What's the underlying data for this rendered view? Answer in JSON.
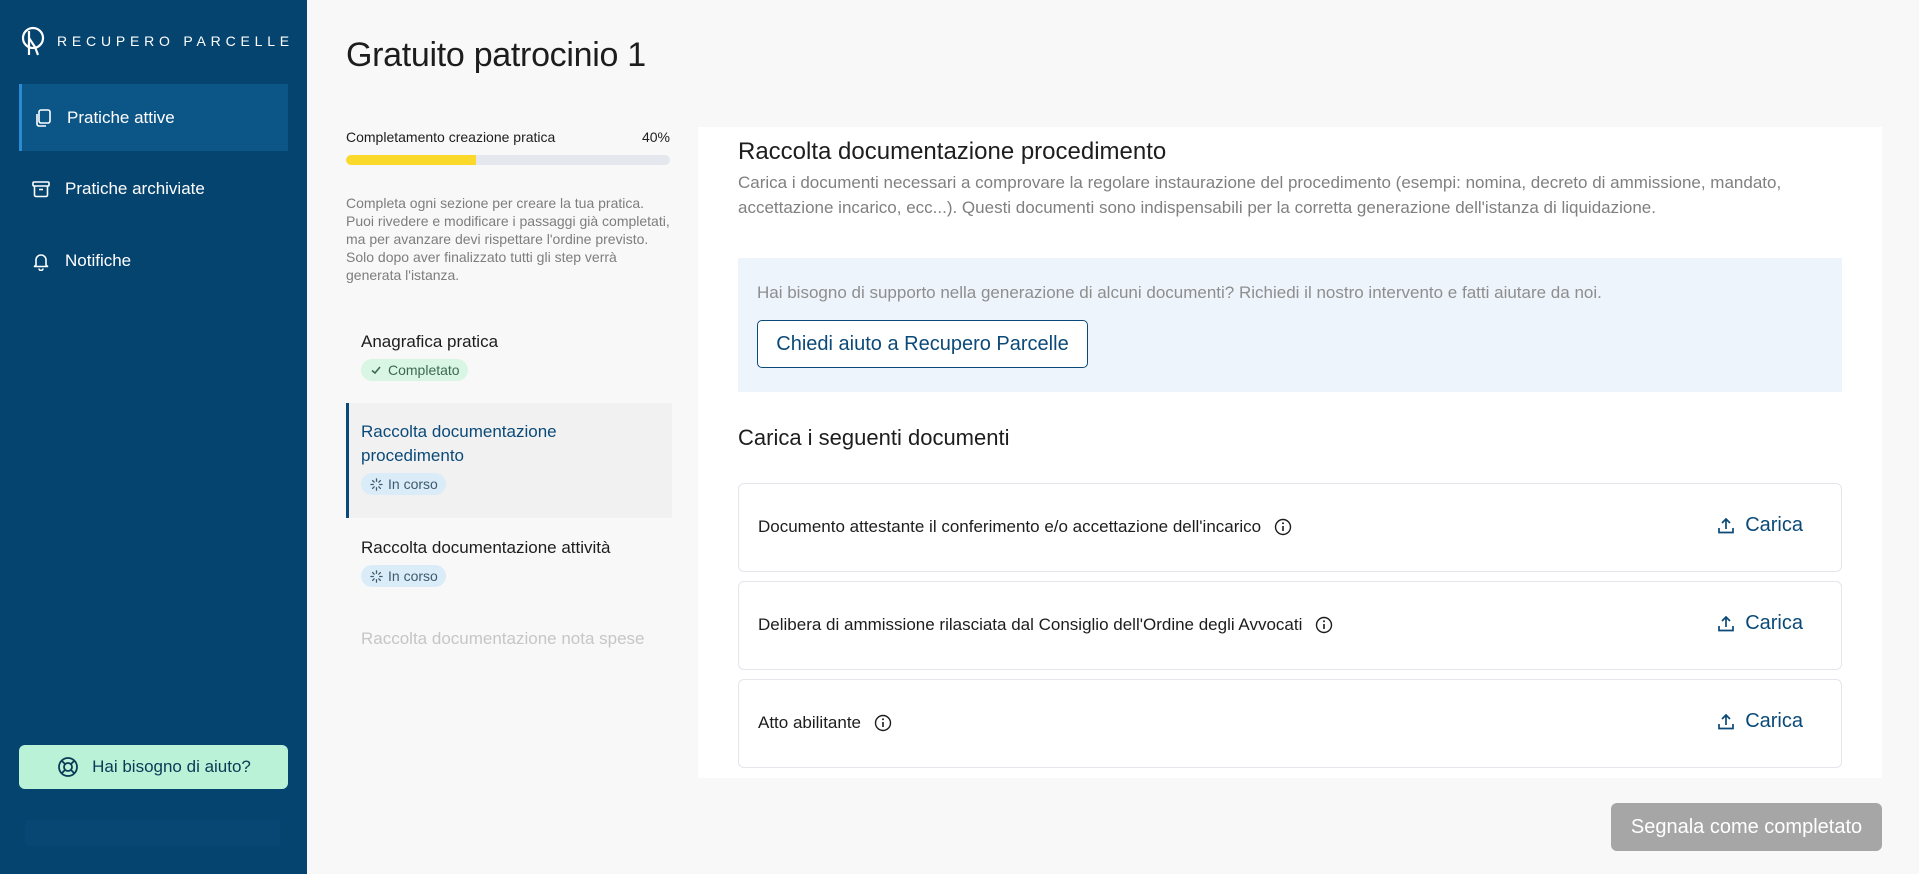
{
  "brand": {
    "name": "RECUPERO PARCELLE"
  },
  "sidebar": {
    "items": [
      {
        "label": "Pratiche attive",
        "icon": "copy-icon",
        "active": true
      },
      {
        "label": "Pratiche archiviate",
        "icon": "archive-icon",
        "active": false
      },
      {
        "label": "Notifiche",
        "icon": "bell-icon",
        "active": false
      }
    ],
    "help_label": "Hai bisogno di aiuto?"
  },
  "page": {
    "title": "Gratuito patrocinio 1"
  },
  "progress": {
    "label": "Completamento creazione pratica",
    "percent_label": "40%",
    "percent": 40,
    "description": "Completa ogni sezione per creare la tua pratica. Puoi rivedere e modificare i passaggi già completati, ma per avanzare devi rispettare l'ordine previsto. Solo dopo aver finalizzato tutti gli step verrà generata l'istanza."
  },
  "steps": [
    {
      "title": "Anagrafica pratica",
      "status": "Completato"
    },
    {
      "title": "Raccolta documentazione procedimento",
      "status": "In corso"
    },
    {
      "title": "Raccolta documentazione attività",
      "status": "In corso"
    },
    {
      "title": "Raccolta documentazione nota spese",
      "status": ""
    }
  ],
  "section": {
    "title": "Raccolta documentazione procedimento",
    "description": "Carica i documenti necessari a comprovare la regolare instaurazione del procedimento (esempi: nomina, decreto di ammissione, mandato, accettazione incarico, ecc...). Questi documenti sono indispensabili per la corretta generazione dell'istanza di liquidazione.",
    "support_text": "Hai bisogno di supporto nella generazione di alcuni documenti? Richiedi il nostro intervento e fatti aiutare da noi.",
    "support_button": "Chiedi aiuto a Recupero Parcelle",
    "upload_title": "Carica i seguenti documenti"
  },
  "documents": [
    {
      "name": "Documento attestante il conferimento e/o accettazione dell'incarico",
      "action": "Carica"
    },
    {
      "name": "Delibera di ammissione rilasciata dal Consiglio dell'Ordine degli Avvocati",
      "action": "Carica"
    },
    {
      "name": "Atto abilitante",
      "action": "Carica"
    }
  ],
  "footer": {
    "complete_button": "Segnala come completato"
  },
  "colors": {
    "sidebar": "#064470",
    "accent": "#0b4a78",
    "progress": "#fbd92a",
    "help": "#b9f2d6"
  }
}
